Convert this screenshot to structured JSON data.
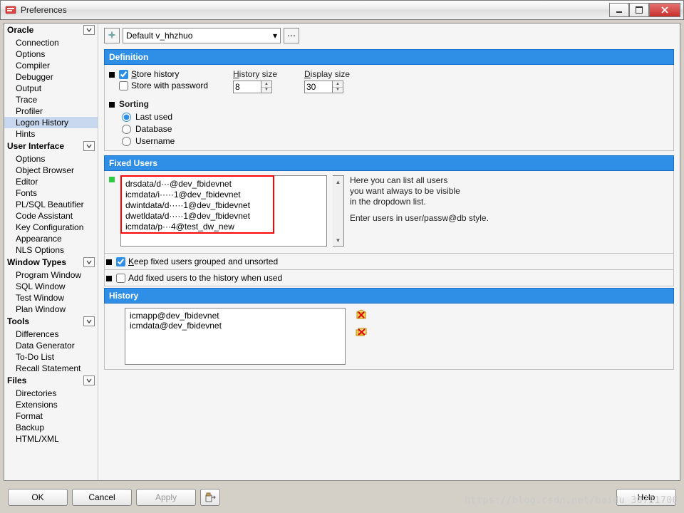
{
  "window": {
    "title": "Preferences"
  },
  "nav": {
    "groups": [
      {
        "label": "Oracle",
        "items": [
          "Connection",
          "Options",
          "Compiler",
          "Debugger",
          "Output",
          "Trace",
          "Profiler",
          "Logon History",
          "Hints"
        ]
      },
      {
        "label": "User Interface",
        "items": [
          "Options",
          "Object Browser",
          "Editor",
          "Fonts",
          "PL/SQL Beautifier",
          "Code Assistant",
          "Key Configuration",
          "Appearance",
          "NLS Options"
        ]
      },
      {
        "label": "Window Types",
        "items": [
          "Program Window",
          "SQL Window",
          "Test Window",
          "Plan Window"
        ]
      },
      {
        "label": "Tools",
        "items": [
          "Differences",
          "Data Generator",
          "To-Do List",
          "Recall Statement"
        ]
      },
      {
        "label": "Files",
        "items": [
          "Directories",
          "Extensions",
          "Format",
          "Backup",
          "HTML/XML"
        ]
      }
    ],
    "selected": "Logon History"
  },
  "profile": {
    "text": "Default v_hhzhuo"
  },
  "definition": {
    "header": "Definition",
    "store_history_label": "Store history",
    "store_history_checked": true,
    "store_password_label": "Store with password",
    "store_password_checked": false,
    "history_size_label": "History size",
    "history_size_value": "8",
    "display_size_label": "Display size",
    "display_size_value": "30",
    "sorting_label": "Sorting",
    "sorting_options": [
      "Last used",
      "Database",
      "Username"
    ],
    "sorting_selected": "Last used"
  },
  "fixed_users": {
    "header": "Fixed Users",
    "entries": "drsdata/d···@dev_fbidevnet\nicmdata/i·····1@dev_fbidevnet\ndwintdata/d·····1@dev_fbidevnet\ndwetldata/d·····1@dev_fbidevnet\nicmdata/p···4@test_dw_new",
    "help_line1": "Here you can list all users",
    "help_line2": "you want always to be visible",
    "help_line3": "in the dropdown list.",
    "help_line4": "Enter users in user/passw@db style.",
    "keep_grouped_label": "Keep fixed users grouped and unsorted",
    "keep_grouped_checked": true,
    "add_to_history_label": "Add fixed users to the history when used",
    "add_to_history_checked": false
  },
  "history": {
    "header": "History",
    "items": [
      "icmapp@dev_fbidevnet",
      "icmdata@dev_fbidevnet"
    ]
  },
  "footer": {
    "ok": "OK",
    "cancel": "Cancel",
    "apply": "Apply",
    "help": "Help"
  },
  "watermark": "https://blog.csdn.net/baidu_30721706"
}
